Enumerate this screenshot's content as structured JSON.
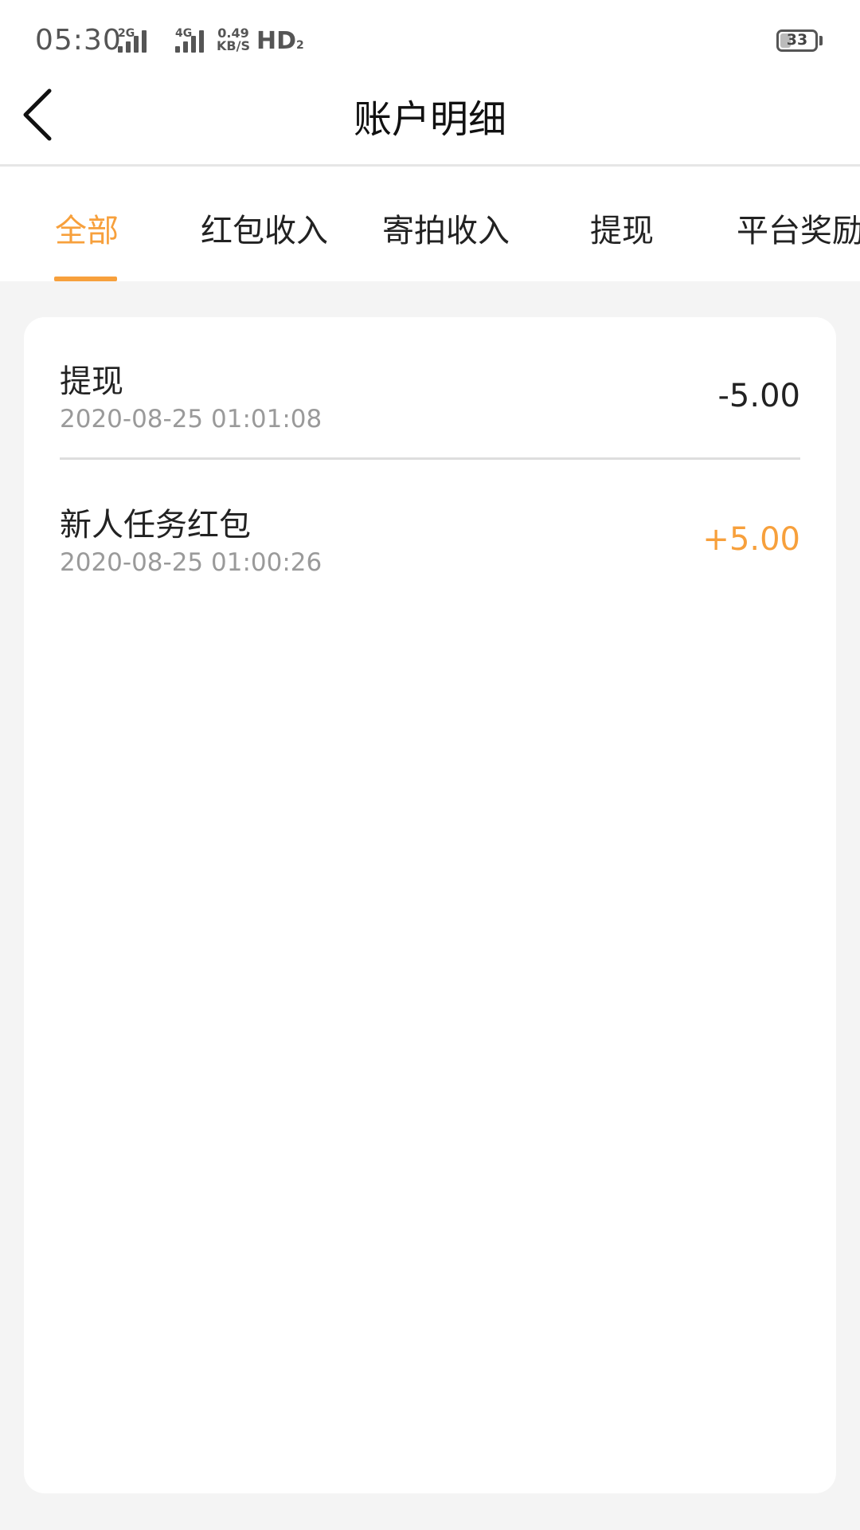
{
  "status_bar": {
    "time": "05:30",
    "sim1_label": "2G",
    "sim2_label": "4G",
    "speed_value": "0.49",
    "speed_unit": "KB/S",
    "hd_label": "HD",
    "hd_sub": "2",
    "battery_level": "33"
  },
  "header": {
    "back_icon": "chevron-left-icon",
    "title": "账户明细"
  },
  "tabs": {
    "active_index": 0,
    "accent_color": "#f7a03c",
    "items": [
      {
        "label": "全部"
      },
      {
        "label": "红包收入"
      },
      {
        "label": "寄拍收入"
      },
      {
        "label": "提现"
      },
      {
        "label": "平台奖励"
      }
    ]
  },
  "records": [
    {
      "title": "提现",
      "time": "2020-08-25 01:01:08",
      "amount": "-5.00",
      "amount_color": "#222222"
    },
    {
      "title": "新人任务红包",
      "time": "2020-08-25 01:00:26",
      "amount": "+5.00",
      "amount_color": "#f7a03c"
    }
  ]
}
